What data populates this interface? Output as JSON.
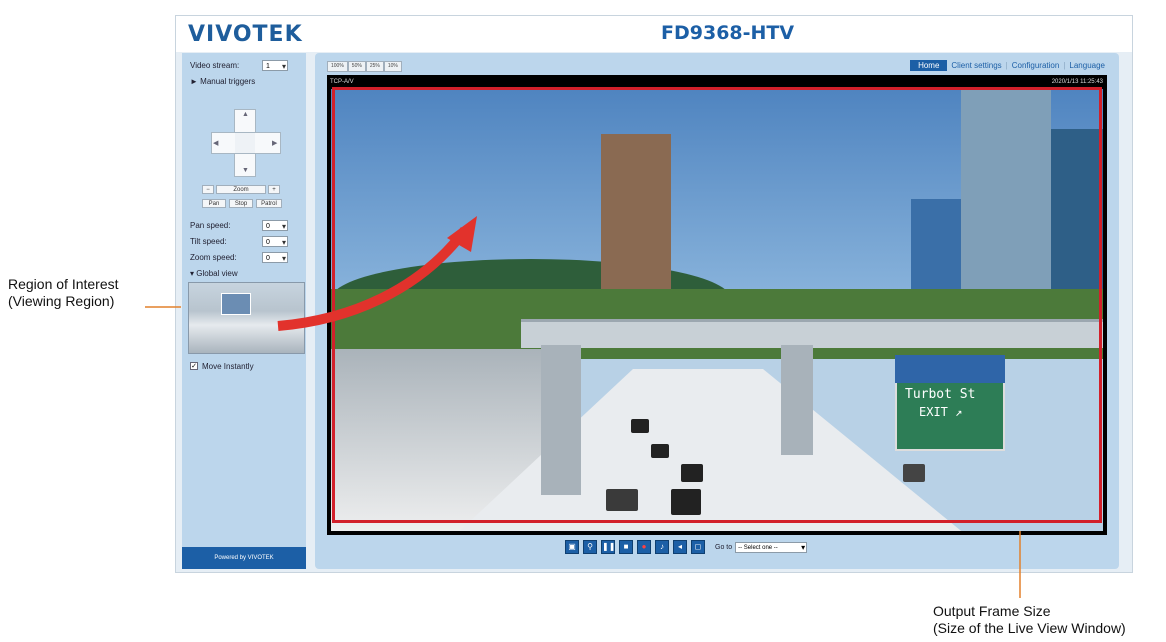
{
  "header": {
    "logo": "VIVOTEK",
    "logo_sub": "",
    "model": "FD9368-HTV"
  },
  "sidebar": {
    "video_stream_label": "Video stream:",
    "video_stream_value": "1",
    "manual_triggers": "Manual triggers",
    "zoom_label": "Zoom",
    "pan_btn": "Pan",
    "stop_btn": "Stop",
    "patrol_btn": "Patrol",
    "pan_speed_label": "Pan speed:",
    "pan_speed_value": "0",
    "tilt_speed_label": "Tilt speed:",
    "tilt_speed_value": "0",
    "zoom_speed_label": "Zoom speed:",
    "zoom_speed_value": "0",
    "global_view": "Global view",
    "move_instantly": "Move Instantly",
    "powered_by": "Powered by VIVOTEK"
  },
  "main": {
    "size_buttons": [
      "100%",
      "50%",
      "25%",
      "10%"
    ],
    "nav": {
      "home": "Home",
      "client_settings": "Client settings",
      "configuration": "Configuration",
      "language": "Language"
    },
    "video_status_left": "TCP-A/V",
    "video_timestamp": "2020/1/13 11:25:43",
    "sign_line1": "Turbot St",
    "sign_line2": "EXIT",
    "goto_label": "Go to",
    "goto_value": "-- Select one --"
  },
  "annotations": {
    "left_line1": "Region of Interest",
    "left_line2": "(Viewing Region)",
    "right_line1": "Output Frame Size",
    "right_line2": "(Size of the Live View Window)"
  },
  "colors": {
    "brand": "#1c5fa6",
    "panel": "#bcd6ec",
    "roi_outline": "#d2202a",
    "annotation_arrow": "#e2322c",
    "callout_line": "#e2812c"
  }
}
